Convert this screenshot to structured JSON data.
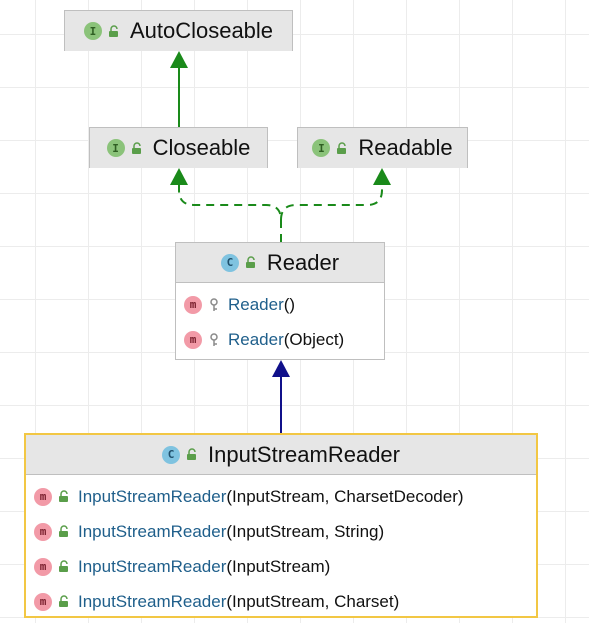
{
  "diagram": {
    "nodes": {
      "autocloseable": {
        "name": "AutoCloseable",
        "badge": "I",
        "badge_kind": "interface"
      },
      "closeable": {
        "name": "Closeable",
        "badge": "I",
        "badge_kind": "interface"
      },
      "readable": {
        "name": "Readable",
        "badge": "I",
        "badge_kind": "interface"
      },
      "reader": {
        "name": "Reader",
        "badge": "C",
        "badge_kind": "class",
        "members": [
          {
            "badge": "m",
            "visibility": "key-icon",
            "name": "Reader",
            "args": "()"
          },
          {
            "badge": "m",
            "visibility": "key-icon",
            "name": "Reader",
            "args": "(Object)"
          }
        ]
      },
      "inputstreamreader": {
        "name": "InputStreamReader",
        "badge": "C",
        "badge_kind": "class",
        "members": [
          {
            "badge": "m",
            "visibility": "unlock-icon",
            "name": "InputStreamReader",
            "args": "(InputStream, CharsetDecoder)"
          },
          {
            "badge": "m",
            "visibility": "unlock-icon",
            "name": "InputStreamReader",
            "args": "(InputStream, String)"
          },
          {
            "badge": "m",
            "visibility": "unlock-icon",
            "name": "InputStreamReader",
            "args": "(InputStream)"
          },
          {
            "badge": "m",
            "visibility": "unlock-icon",
            "name": "InputStreamReader",
            "args": "(InputStream, Charset)"
          }
        ]
      }
    },
    "colors": {
      "extends_interface": "#1a8a1a",
      "implements": "#1a8a1a",
      "extends_class": "#10108a",
      "selected_border": "#f2c744"
    }
  }
}
